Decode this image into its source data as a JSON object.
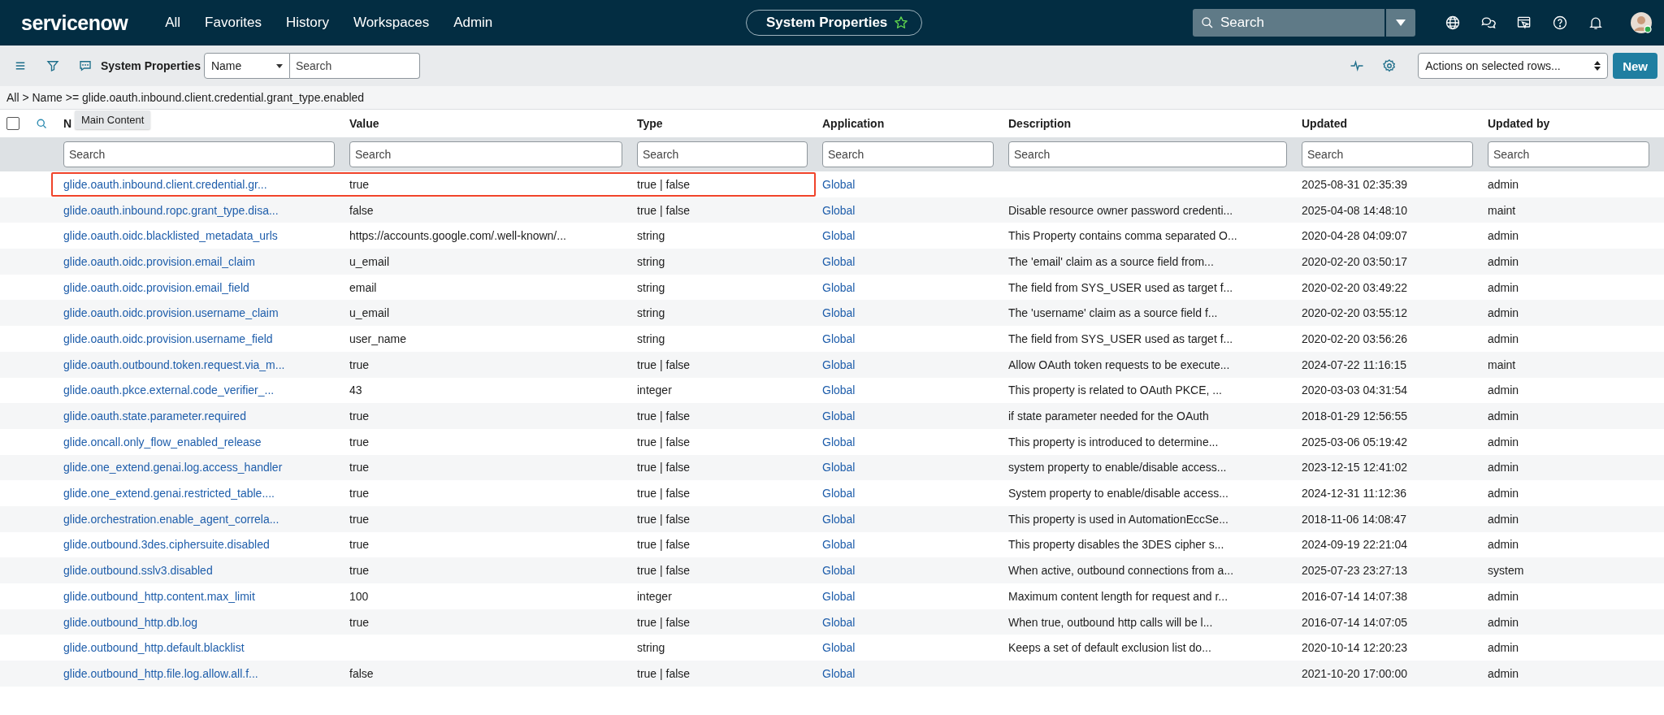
{
  "top_bar": {
    "logo": "servicenow",
    "nav": [
      "All",
      "Favorites",
      "History",
      "Workspaces",
      "Admin"
    ],
    "context_title": "System Properties",
    "context_favorite": false,
    "search": {
      "placeholder": "Search"
    }
  },
  "toolbar": {
    "title": "System Properties",
    "field_select": "Name",
    "search": {
      "placeholder": "Search"
    },
    "actions_select": "Actions on selected rows...",
    "new_button": "New"
  },
  "breadcrumb": "All > Name >= glide.oauth.inbound.client.credential.grant_type.enabled",
  "tooltip": "Main Content",
  "table": {
    "select_all_checked": false,
    "columns": [
      {
        "label": "N",
        "search_placeholder": "Search"
      },
      {
        "label": "Value",
        "search_placeholder": "Search"
      },
      {
        "label": "Type",
        "search_placeholder": "Search"
      },
      {
        "label": "Application",
        "search_placeholder": "Search"
      },
      {
        "label": "Description",
        "search_placeholder": "Search"
      },
      {
        "label": "Updated",
        "search_placeholder": "Search"
      },
      {
        "label": "Updated by",
        "search_placeholder": "Search"
      }
    ],
    "rows": [
      {
        "name": "glide.oauth.inbound.client.credential.gr...",
        "value": "true",
        "type": "true | false",
        "application": "Global",
        "description": "",
        "updated": "2025-08-31 02:35:39",
        "updated_by": "admin",
        "highlighted": true
      },
      {
        "name": "glide.oauth.inbound.ropc.grant_type.disa...",
        "value": "false",
        "type": "true | false",
        "application": "Global",
        "description": "Disable resource owner password credenti...",
        "updated": "2025-04-08 14:48:10",
        "updated_by": "maint",
        "highlighted": false
      },
      {
        "name": "glide.oauth.oidc.blacklisted_metadata_urls",
        "value": "https://accounts.google.com/.well-known/...",
        "type": "string",
        "application": "Global",
        "description": "This Property contains comma separated O...",
        "updated": "2020-04-28 04:09:07",
        "updated_by": "admin",
        "highlighted": false
      },
      {
        "name": "glide.oauth.oidc.provision.email_claim",
        "value": "u_email",
        "type": "string",
        "application": "Global",
        "description": "The 'email' claim as a source field from...",
        "updated": "2020-02-20 03:50:17",
        "updated_by": "admin",
        "highlighted": false
      },
      {
        "name": "glide.oauth.oidc.provision.email_field",
        "value": "email",
        "type": "string",
        "application": "Global",
        "description": "The field from SYS_USER used as target f...",
        "updated": "2020-02-20 03:49:22",
        "updated_by": "admin",
        "highlighted": false
      },
      {
        "name": "glide.oauth.oidc.provision.username_claim",
        "value": "u_email",
        "type": "string",
        "application": "Global",
        "description": "The 'username' claim as a source field f...",
        "updated": "2020-02-20 03:55:12",
        "updated_by": "admin",
        "highlighted": false
      },
      {
        "name": "glide.oauth.oidc.provision.username_field",
        "value": "user_name",
        "type": "string",
        "application": "Global",
        "description": "The field from SYS_USER used as target f...",
        "updated": "2020-02-20 03:56:26",
        "updated_by": "admin",
        "highlighted": false
      },
      {
        "name": "glide.oauth.outbound.token.request.via_m...",
        "value": "true",
        "type": "true | false",
        "application": "Global",
        "description": "Allow OAuth token requests to be execute...",
        "updated": "2024-07-22 11:16:15",
        "updated_by": "maint",
        "highlighted": false
      },
      {
        "name": "glide.oauth.pkce.external.code_verifier_...",
        "value": "43",
        "type": "integer",
        "application": "Global",
        "description": "This property is related to OAuth PKCE, ...",
        "updated": "2020-03-03 04:31:54",
        "updated_by": "admin",
        "highlighted": false
      },
      {
        "name": "glide.oauth.state.parameter.required",
        "value": "true",
        "type": "true | false",
        "application": "Global",
        "description": "if state parameter needed for the OAuth",
        "updated": "2018-01-29 12:56:55",
        "updated_by": "admin",
        "highlighted": false
      },
      {
        "name": "glide.oncall.only_flow_enabled_release",
        "value": "true",
        "type": "true | false",
        "application": "Global",
        "description": "This property is introduced to determine...",
        "updated": "2025-03-06 05:19:42",
        "updated_by": "admin",
        "highlighted": false
      },
      {
        "name": "glide.one_extend.genai.log.access_handler",
        "value": "true",
        "type": "true | false",
        "application": "Global",
        "description": "system property to enable/disable access...",
        "updated": "2023-12-15 12:41:02",
        "updated_by": "admin",
        "highlighted": false
      },
      {
        "name": "glide.one_extend.genai.restricted_table....",
        "value": "true",
        "type": "true | false",
        "application": "Global",
        "description": "System property to enable/disable access...",
        "updated": "2024-12-31 11:12:36",
        "updated_by": "admin",
        "highlighted": false
      },
      {
        "name": "glide.orchestration.enable_agent_correla...",
        "value": "true",
        "type": "true | false",
        "application": "Global",
        "description": "This property is used in AutomationEccSe...",
        "updated": "2018-11-06 14:08:47",
        "updated_by": "admin",
        "highlighted": false
      },
      {
        "name": "glide.outbound.3des.ciphersuite.disabled",
        "value": "true",
        "type": "true | false",
        "application": "Global",
        "description": "This property disables the 3DES cipher s...",
        "updated": "2024-09-19 22:21:04",
        "updated_by": "admin",
        "highlighted": false
      },
      {
        "name": "glide.outbound.sslv3.disabled",
        "value": "true",
        "type": "true | false",
        "application": "Global",
        "description": "When active, outbound connections from a...",
        "updated": "2025-07-23 23:27:13",
        "updated_by": "system",
        "highlighted": false
      },
      {
        "name": "glide.outbound_http.content.max_limit",
        "value": "100",
        "type": "integer",
        "application": "Global",
        "description": "Maximum content length for request and r...",
        "updated": "2016-07-14 14:07:38",
        "updated_by": "admin",
        "highlighted": false
      },
      {
        "name": "glide.outbound_http.db.log",
        "value": "true",
        "type": "true | false",
        "application": "Global",
        "description": "When true, outbound http calls will be l...",
        "updated": "2016-07-14 14:07:05",
        "updated_by": "admin",
        "highlighted": false
      },
      {
        "name": "glide.outbound_http.default.blacklist",
        "value": "",
        "type": "string",
        "application": "Global",
        "description": "Keeps a set of default exclusion list do...",
        "updated": "2020-10-14 12:20:23",
        "updated_by": "admin",
        "highlighted": false
      },
      {
        "name": "glide.outbound_http.file.log.allow.all.f...",
        "value": "false",
        "type": "true | false",
        "application": "Global",
        "description": "",
        "updated": "2021-10-20 17:00:00",
        "updated_by": "admin",
        "highlighted": false
      }
    ]
  }
}
